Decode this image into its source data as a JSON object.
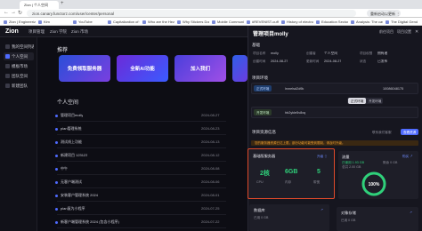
{
  "browser": {
    "tab_title": "Zion | 个人空间",
    "new_tab": "+",
    "back": "←",
    "forward": "→",
    "reload": "↻",
    "url": "zion.canary.functorz.com/user/center/personal",
    "profile": "重新启动以更新 ⋮",
    "bookmarks": [
      "Zion | Engineeriz...",
      "Kim",
      "YouTube",
      "Capitalization of t...",
      "Who are the Hezb...",
      "Why Stickers Don...",
      "Mobile Communic...",
      "#REVENIST-cuff",
      "History of electron...",
      "Education Sector...",
      "Analysis: The case...",
      "The Digital Gender..."
    ]
  },
  "app": {
    "logo": "Zion",
    "nav": [
      "项目管理",
      "Zion 学院",
      "Zion 市场"
    ],
    "sidebar": [
      {
        "label": "我的空间列表",
        "active": false
      },
      {
        "label": "个人空间",
        "active": true
      },
      {
        "label": "模板市场",
        "active": false
      },
      {
        "label": "团队空间",
        "active": false
      },
      {
        "label": "新建团队",
        "active": false
      }
    ]
  },
  "main": {
    "recommend_title": "推荐",
    "banners": [
      "免费领取服务器",
      "全新AI功能",
      "加入我们",
      ""
    ],
    "personal_title": "个人空间",
    "rows": [
      {
        "name": "管理项目molly",
        "date": "2024-08-27"
      },
      {
        "name": "plan管理系统",
        "date": "2024-08-23"
      },
      {
        "name": "测试线上功能",
        "date": "2024-08-13"
      },
      {
        "name": "新建项目 123123",
        "date": "2024-08-12"
      },
      {
        "name": "中午",
        "date": "2024-08-08"
      },
      {
        "name": "无客户端测试",
        "date": "2024-08-06"
      },
      {
        "name": "安装客户管理系统 2024",
        "date": "2024-08-01"
      },
      {
        "name": "plan复为小程序",
        "date": "2024-07-25"
      },
      {
        "name": "新客户端管理系统 2024 (包含小程序)",
        "date": "2024-07-22"
      }
    ]
  },
  "drawer": {
    "title": "管理项目molly",
    "actions": [
      "前往项目",
      "项目设置",
      "✕"
    ],
    "basic_title": "基础",
    "basic_fields": [
      {
        "k": "项目名称",
        "v": "molly"
      },
      {
        "k": "创建者",
        "v": "个人空间"
      },
      {
        "k": "项目权限",
        "v": "拥有者"
      },
      {
        "k": "创建时间",
        "v": "2024-08-27"
      },
      {
        "k": "更新时间",
        "v": "2024-08-27"
      },
      {
        "k": "状态",
        "v": "已发布"
      }
    ],
    "env_title": "项目环境",
    "env_rows": [
      {
        "chip": "正式环境",
        "id": "lrxnelsd2d9k",
        "extra": "10086048175"
      },
      {
        "chip": "开发环境",
        "id": "hb2ykle5v8xq",
        "extra": ""
      }
    ],
    "env_tabs": [
      "正式环境",
      "开发环境"
    ],
    "resource_title": "项目资源信息",
    "resource_actions": [
      "联系我们客服",
      "查看资源"
    ],
    "warning": "您的服务器资源已达上限，部分功能可能受到限制，请及时升级。",
    "server_card": {
      "title": "基础版服务器",
      "link": "升级 ⇧",
      "stats": [
        {
          "value": "2核",
          "label": "CPU"
        },
        {
          "value": "6GB",
          "label": "内存"
        },
        {
          "value": "5",
          "label": "带宽"
        }
      ]
    },
    "traffic_card": {
      "title": "流量",
      "link": "购买 ↗",
      "lines": [
        "已使用 1.93 GB",
        "总共 2.00 GB",
        "剩余 0 GB"
      ],
      "percent_label": "100%"
    },
    "db_card": {
      "title": "数据库",
      "link": "↗",
      "line": "已用 0 GB"
    },
    "storage_card": {
      "title": "对象存储",
      "link": "↗",
      "line": "已用 0 GB"
    }
  },
  "colors": {
    "accent": "#4f6bff",
    "success": "#2fd07a",
    "warning": "#f0a030",
    "highlight": "#e04a2a"
  }
}
